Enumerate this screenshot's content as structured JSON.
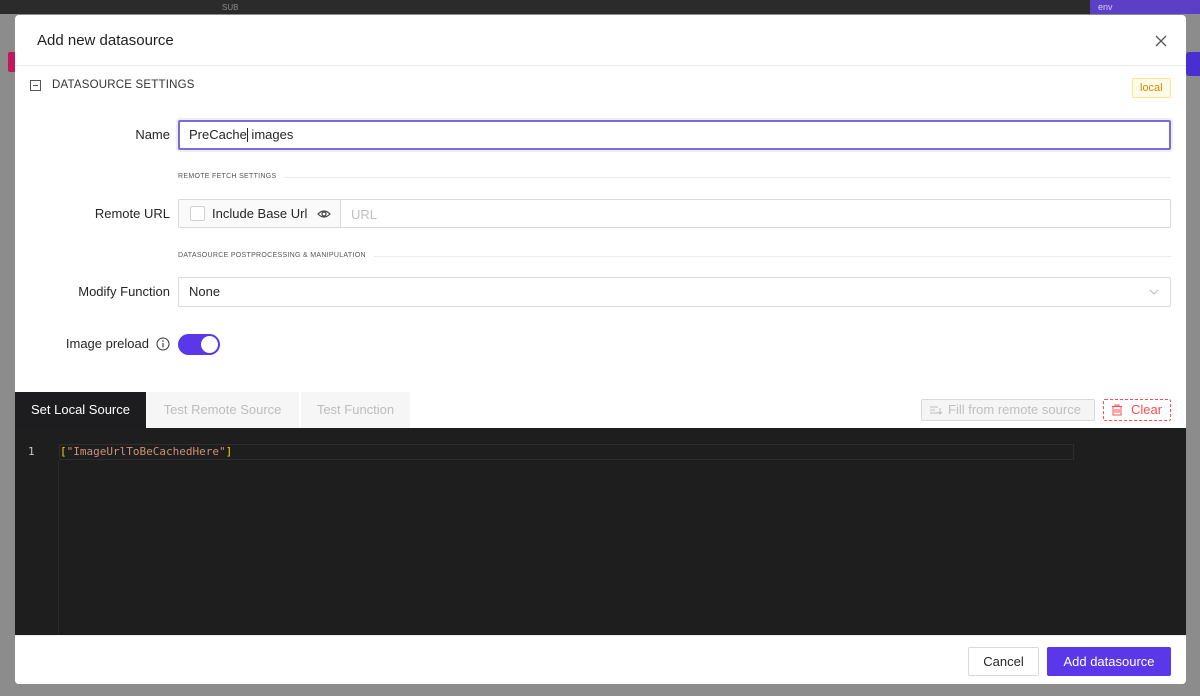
{
  "backdrop": {
    "header_sub": "SUB",
    "env_label": "env"
  },
  "modal": {
    "title": "Add new datasource",
    "section_title": "DATASOURCE SETTINGS",
    "badge": "local",
    "name": {
      "label": "Name",
      "value_before_caret": "PreCache",
      "value_after_caret": " images"
    },
    "remote_fetch_divider": "REMOTE FETCH SETTINGS",
    "remote_url": {
      "label": "Remote URL",
      "include_base_url_label": "Include Base Url",
      "include_base_url_checked": false,
      "placeholder": "URL"
    },
    "postprocessing_divider": "DATASOURCE POSTPROCESSING & MANIPULATION",
    "modify_function": {
      "label": "Modify Function",
      "value": "None"
    },
    "image_preload": {
      "label": "Image preload",
      "enabled": true
    },
    "tabs": [
      {
        "label": "Set Local Source",
        "active": true
      },
      {
        "label": "Test Remote Source",
        "active": false
      },
      {
        "label": "Test Function",
        "active": false
      }
    ],
    "fill_button": "Fill from remote source",
    "clear_button": "Clear",
    "editor": {
      "line_number": "1",
      "code": "\"ImageUrlToBeCachedHere\"",
      "open_bracket": "[",
      "close_bracket": "]"
    },
    "footer": {
      "cancel": "Cancel",
      "submit": "Add datasource"
    }
  },
  "colors": {
    "accent": "#5a37e8",
    "danger": "#ff4d4f",
    "badge": "#d48806",
    "editor_bg": "#1e1e1f"
  }
}
